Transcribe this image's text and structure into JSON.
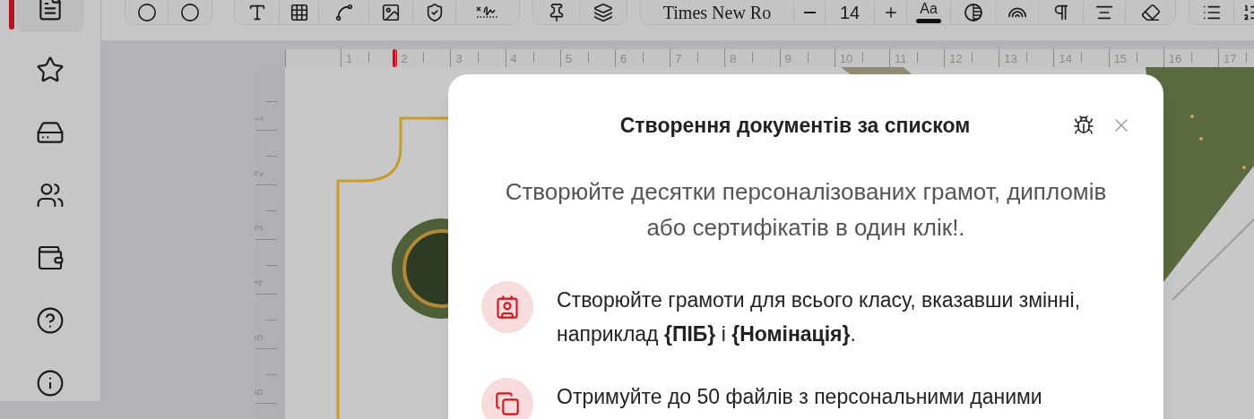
{
  "sidebar": {
    "items": [
      {
        "selected": true
      },
      {
        "selected": false
      },
      {
        "selected": false
      },
      {
        "selected": false
      },
      {
        "selected": false
      },
      {
        "selected": false
      },
      {
        "selected": false
      }
    ]
  },
  "toolbar": {
    "font_name": "Times New Ro",
    "font_size": "14",
    "text_style_label": "Aa"
  },
  "ruler": {
    "horizontal_labels": [
      "1",
      "2",
      "3",
      "4",
      "5",
      "6",
      "7",
      "8",
      "9",
      "10",
      "11",
      "12",
      "13",
      "14",
      "15",
      "16",
      "17"
    ],
    "vertical_labels": [
      "1",
      "2",
      "3",
      "4",
      "5",
      "6"
    ]
  },
  "dialog": {
    "title": "Створення документів за списком",
    "subtitle": "Створюйте десятки персоналізованих грамот, дипломів або сертифікатів в один клік!.",
    "features": [
      {
        "text": "Створюйте грамоти для всього класу, вказавши змінні, наприклад **{ПІБ}** і **{Номінація}**."
      },
      {
        "text": "Отримуйте до 50 файлів з персональними даними"
      }
    ]
  }
}
